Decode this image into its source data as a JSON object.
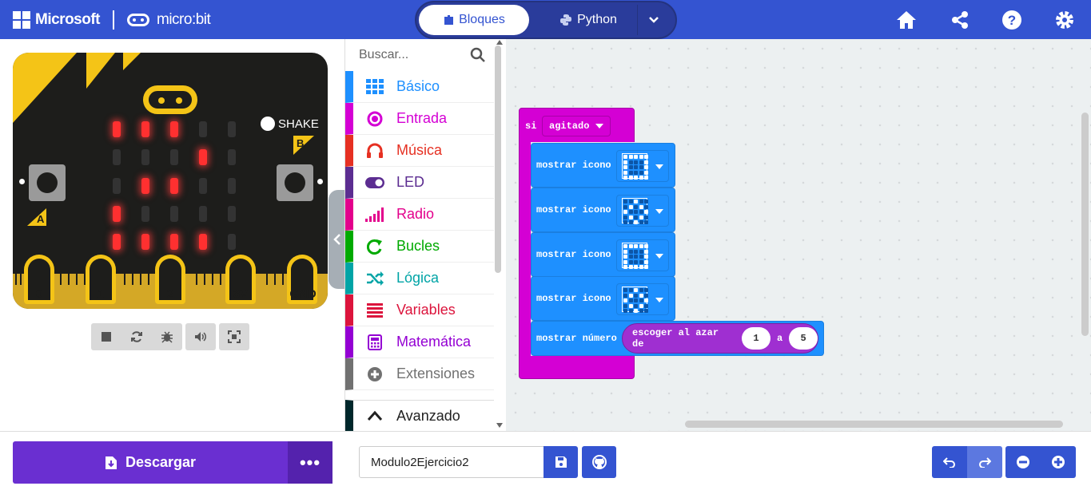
{
  "header": {
    "brand": "Microsoft",
    "product": "micro:bit",
    "toggle_blocks": "Bloques",
    "toggle_python": "Python"
  },
  "simulator": {
    "shake_label": "SHAKE",
    "button_a": "A",
    "button_b": "B",
    "pins": [
      "0",
      "1",
      "2",
      "3V",
      "GND"
    ],
    "led_matrix": [
      [
        1,
        1,
        1,
        0,
        0
      ],
      [
        0,
        0,
        0,
        1,
        0
      ],
      [
        0,
        1,
        1,
        0,
        0
      ],
      [
        1,
        0,
        0,
        0,
        0
      ],
      [
        1,
        1,
        1,
        1,
        0
      ]
    ]
  },
  "toolbox": {
    "search_placeholder": "Buscar...",
    "categories": [
      {
        "label": "Básico",
        "color": "#1e90ff",
        "icon": "grid-icon"
      },
      {
        "label": "Entrada",
        "color": "#d400d4",
        "icon": "input-icon"
      },
      {
        "label": "Música",
        "color": "#e63022",
        "icon": "headphones-icon"
      },
      {
        "label": "LED",
        "color": "#5c2d91",
        "icon": "toggle-icon"
      },
      {
        "label": "Radio",
        "color": "#e3008c",
        "icon": "signal-icon"
      },
      {
        "label": "Bucles",
        "color": "#00aa00",
        "icon": "loop-icon"
      },
      {
        "label": "Lógica",
        "color": "#00a4a6",
        "icon": "shuffle-icon"
      },
      {
        "label": "Variables",
        "color": "#dc143c",
        "icon": "list-icon"
      },
      {
        "label": "Matemática",
        "color": "#9400d3",
        "icon": "calculator-icon"
      },
      {
        "label": "Extensiones",
        "color": "#717171",
        "icon": "plus-circle-icon"
      },
      {
        "label": "Avanzado",
        "color": "#00272b",
        "icon": "chevron-up-icon"
      }
    ]
  },
  "workspace": {
    "if_block": {
      "keyword": "si",
      "event": "agitado"
    },
    "show_icon_label": "mostrar icono",
    "show_number_label": "mostrar número",
    "random_label": "escoger al azar de",
    "random_sep": "a",
    "random_from": "1",
    "random_to": "5",
    "icons": [
      [
        [
          1,
          1,
          1,
          1,
          1
        ],
        [
          1,
          0,
          0,
          0,
          1
        ],
        [
          1,
          0,
          0,
          0,
          1
        ],
        [
          1,
          0,
          0,
          0,
          1
        ],
        [
          1,
          1,
          1,
          1,
          1
        ]
      ],
      [
        [
          0,
          0,
          1,
          0,
          0
        ],
        [
          0,
          1,
          0,
          1,
          0
        ],
        [
          1,
          0,
          0,
          0,
          1
        ],
        [
          0,
          1,
          0,
          1,
          0
        ],
        [
          0,
          0,
          1,
          0,
          0
        ]
      ],
      [
        [
          1,
          1,
          1,
          1,
          1
        ],
        [
          1,
          0,
          0,
          0,
          1
        ],
        [
          1,
          0,
          0,
          0,
          1
        ],
        [
          1,
          0,
          0,
          0,
          1
        ],
        [
          1,
          1,
          1,
          1,
          1
        ]
      ],
      [
        [
          0,
          0,
          1,
          0,
          0
        ],
        [
          0,
          1,
          0,
          1,
          0
        ],
        [
          1,
          0,
          0,
          0,
          1
        ],
        [
          0,
          1,
          0,
          1,
          0
        ],
        [
          0,
          0,
          1,
          0,
          0
        ]
      ]
    ]
  },
  "footer": {
    "download_label": "Descargar",
    "more_label": "•••",
    "project_name": "Modulo2Ejercicio2"
  }
}
